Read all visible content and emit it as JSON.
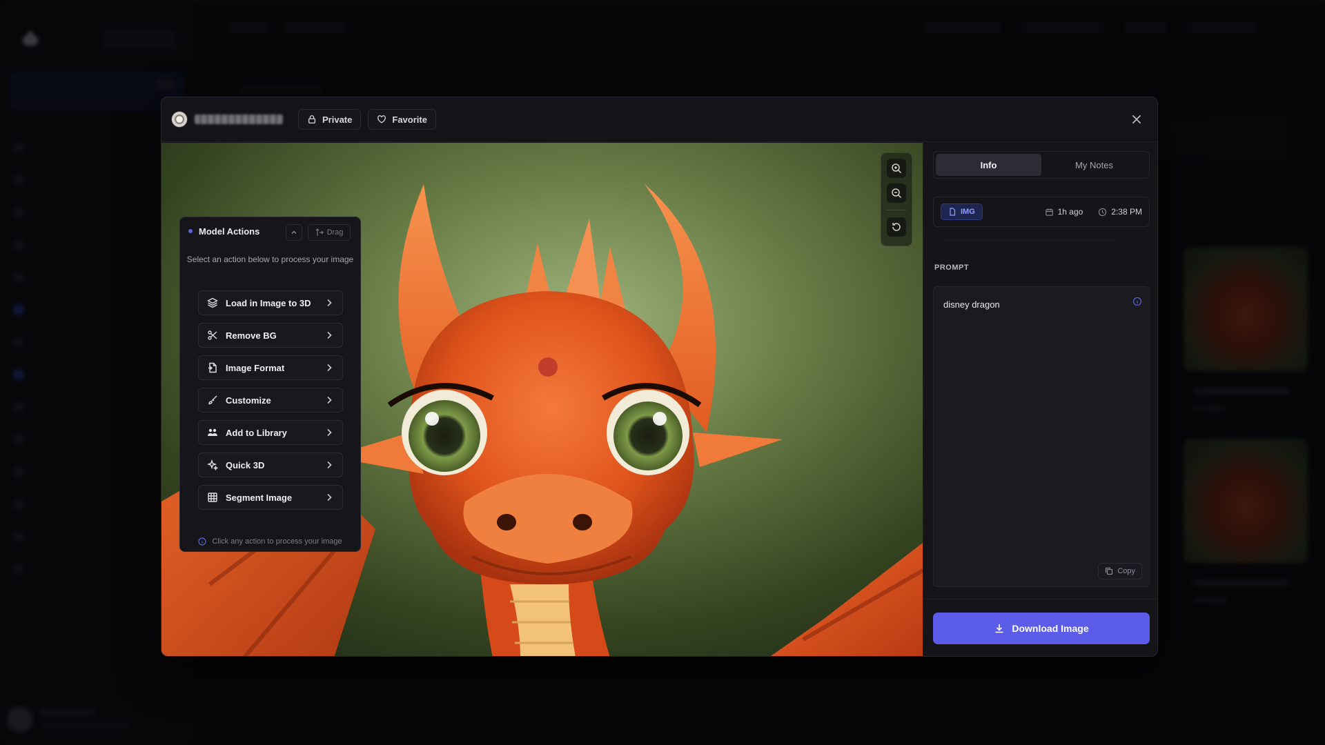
{
  "modal": {
    "privacy_label": "Private",
    "favorite_label": "Favorite"
  },
  "model_actions": {
    "title": "Model Actions",
    "drag_label": "Drag",
    "subtitle": "Select an action below to process your image",
    "items": [
      {
        "label": "Load in Image to 3D",
        "icon": "layers-icon"
      },
      {
        "label": "Remove BG",
        "icon": "scissors-icon"
      },
      {
        "label": "Image Format",
        "icon": "file-convert-icon"
      },
      {
        "label": "Customize",
        "icon": "paint-brush-icon"
      },
      {
        "label": "Add to Library",
        "icon": "users-icon"
      },
      {
        "label": "Quick 3D",
        "icon": "sparkles-icon"
      },
      {
        "label": "Segment Image",
        "icon": "grid-icon"
      }
    ],
    "footer_hint": "Click any action to process your image"
  },
  "info_panel": {
    "tabs": [
      {
        "label": "Info",
        "active": true
      },
      {
        "label": "My Notes",
        "active": false
      }
    ],
    "type_badge": "IMG",
    "relative_time": "1h ago",
    "time": "2:38 PM",
    "prompt_heading": "PROMPT",
    "prompt_text": "disney dragon",
    "copy_label": "Copy",
    "download_label": "Download Image"
  },
  "colors": {
    "accent": "#5b5ce8",
    "badge_text": "#8ea0ff",
    "modal_bg": "#131318"
  }
}
